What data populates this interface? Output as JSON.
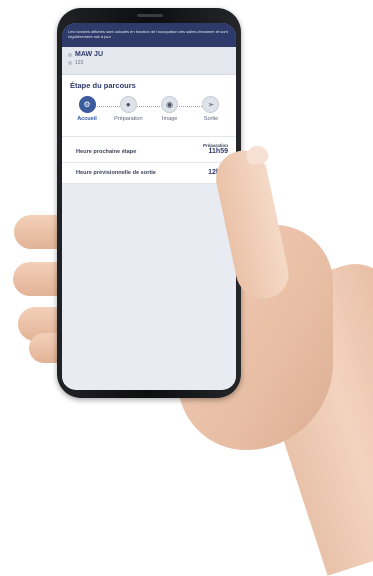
{
  "banner_text": "Les horaires affichés sont calculés en fonction de l'occupation des salles d'examen et sont régulièrement mis à jour",
  "patient": {
    "name": "MAW JU",
    "id": "123"
  },
  "journey": {
    "title": "Étape du parcours",
    "steps": [
      {
        "label": "Accueil",
        "active": true,
        "icon": "reception-icon"
      },
      {
        "label": "Préparation",
        "active": false,
        "icon": "person-icon"
      },
      {
        "label": "Image",
        "active": false,
        "icon": "scan-icon"
      },
      {
        "label": "Sortie",
        "active": false,
        "icon": "exit-icon"
      }
    ]
  },
  "next_step": {
    "label": "Heure prochaine étape",
    "step_name": "Préparation",
    "time": "11h59"
  },
  "exit_time": {
    "label": "Heure prévisionnelle de sortie",
    "time": "12h59"
  },
  "colors": {
    "primary": "#2e3a6a",
    "accent": "#3b5b9c",
    "background": "#e8ebf1"
  }
}
